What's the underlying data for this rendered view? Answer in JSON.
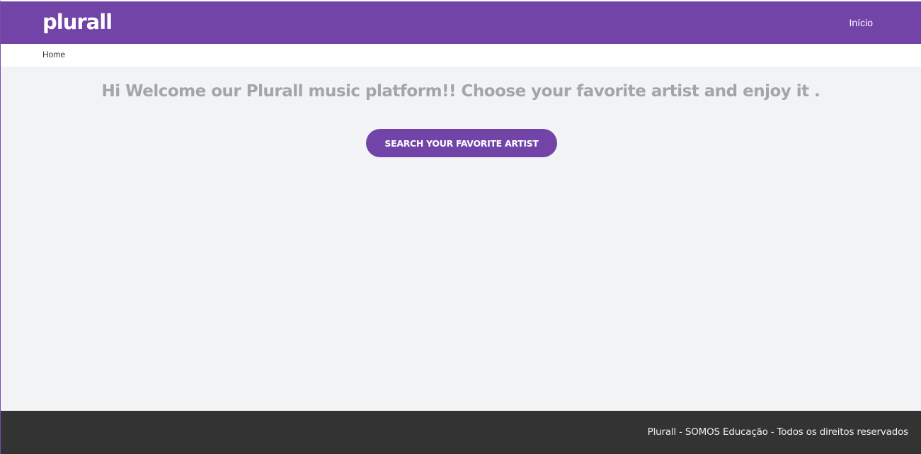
{
  "header": {
    "logo_text": "plurall",
    "nav_link": "Início",
    "brand_color": "#7244a8"
  },
  "breadcrumb": {
    "current": "Home"
  },
  "main": {
    "welcome_text": "Hi Welcome our Plurall music platform!! Choose your favorite artist and enjoy it .",
    "search_button_label": "SEARCH YOUR FAVORITE ARTIST"
  },
  "footer": {
    "copyright": "Plurall - SOMOS Educação - Todos os direitos reservados",
    "background_color": "#333333"
  }
}
